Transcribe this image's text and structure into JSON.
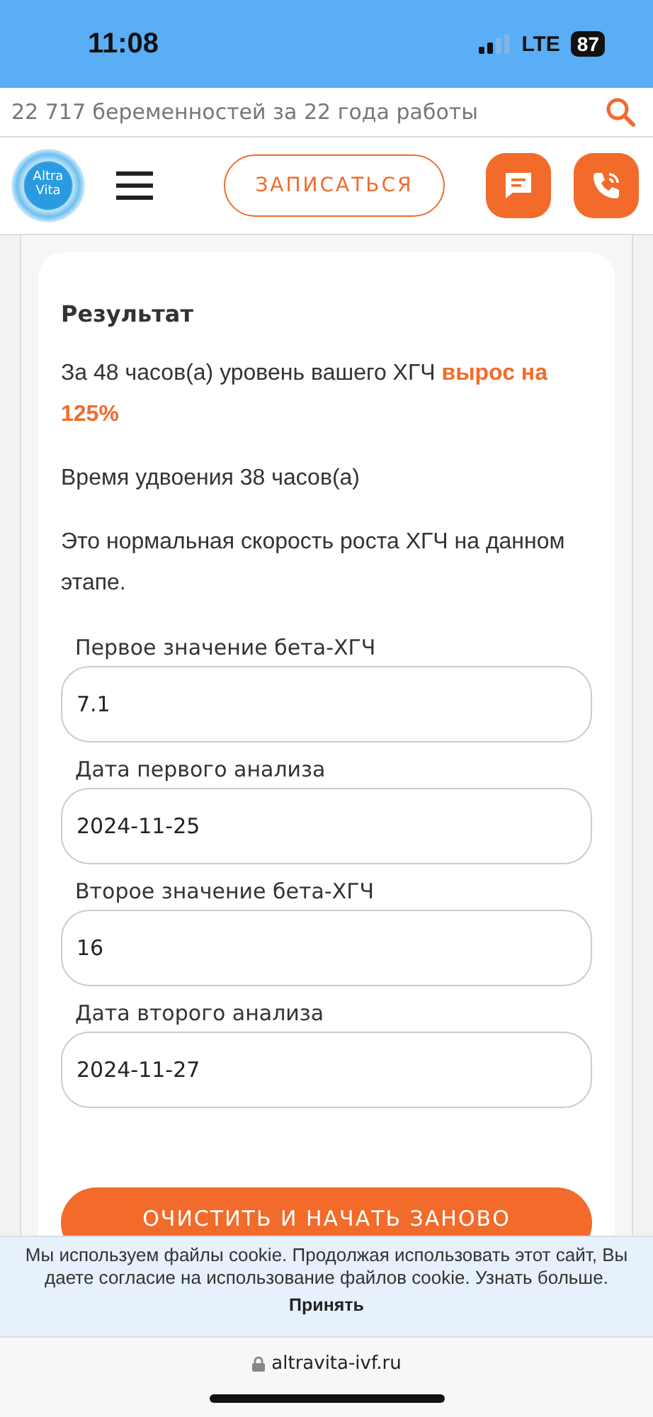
{
  "status_bar": {
    "time": "11:08",
    "network": "LTE",
    "battery": "87"
  },
  "top_bar": {
    "tagline": "22 717 беременностей за 22 года работы"
  },
  "header": {
    "logo_lines": [
      "Altra",
      "Vita"
    ],
    "signup_button": "ЗАПИСАТЬСЯ"
  },
  "result": {
    "title": "Результат",
    "growth": {
      "text": "За 48 часов(а) уровень вашего ХГЧ ",
      "highlight": "вырос на 125%"
    },
    "doubling": "Время удвоения 38 часов(а)",
    "verdict": "Это нормальная скорость роста ХГЧ на данном этапе."
  },
  "fields": [
    {
      "label": "Первое значение бета-ХГЧ",
      "value": "7.1"
    },
    {
      "label": "Дата первого анализа",
      "value": "2024-11-25"
    },
    {
      "label": "Второе значение бета-ХГЧ",
      "value": "16"
    },
    {
      "label": "Дата второго анализа",
      "value": "2024-11-27"
    }
  ],
  "reset_button": "ОЧИСТИТЬ И НАЧАТЬ ЗАНОВО",
  "cookie_banner": {
    "text": "Мы используем файлы cookie. Продолжая использовать этот сайт, Вы даете согласие на использование файлов cookie. Узнать больше.",
    "accept": "Принять"
  },
  "browser_bar": {
    "url": "altravita-ivf.ru"
  }
}
